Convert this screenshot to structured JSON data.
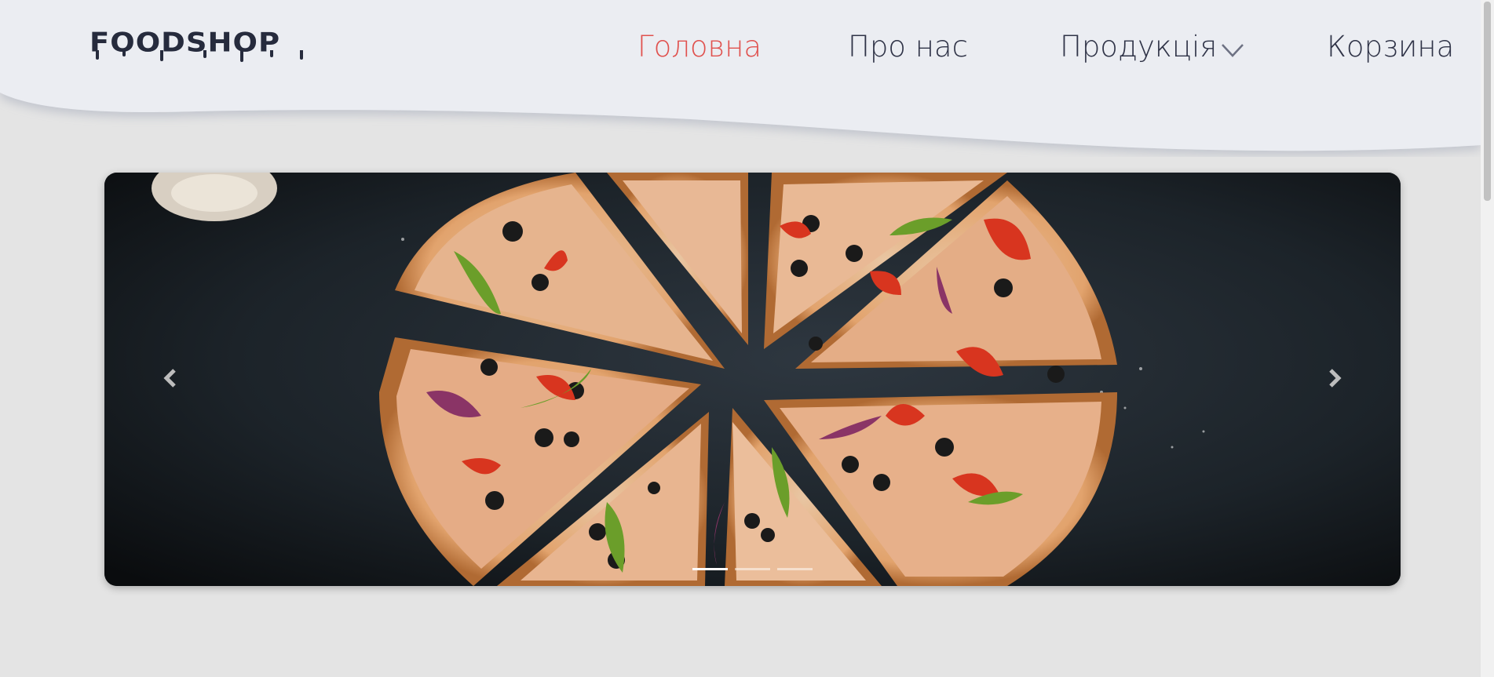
{
  "brand": {
    "logo_text": "FOODSHOP"
  },
  "nav": {
    "items": [
      {
        "label": "Головна",
        "active": true
      },
      {
        "label": "Про нас",
        "active": false
      },
      {
        "label": "Продукція",
        "active": false,
        "has_dropdown": true
      },
      {
        "label": "Корзина",
        "active": false
      }
    ]
  },
  "carousel": {
    "slide_count": 3,
    "active_index": 0,
    "prev_icon": "chevron-left-icon",
    "next_icon": "chevron-right-icon"
  },
  "colors": {
    "accent": "#e0514e",
    "nav_text": "#2f3347",
    "header_bg": "#ebedf2",
    "page_bg": "#e4e4e4"
  }
}
